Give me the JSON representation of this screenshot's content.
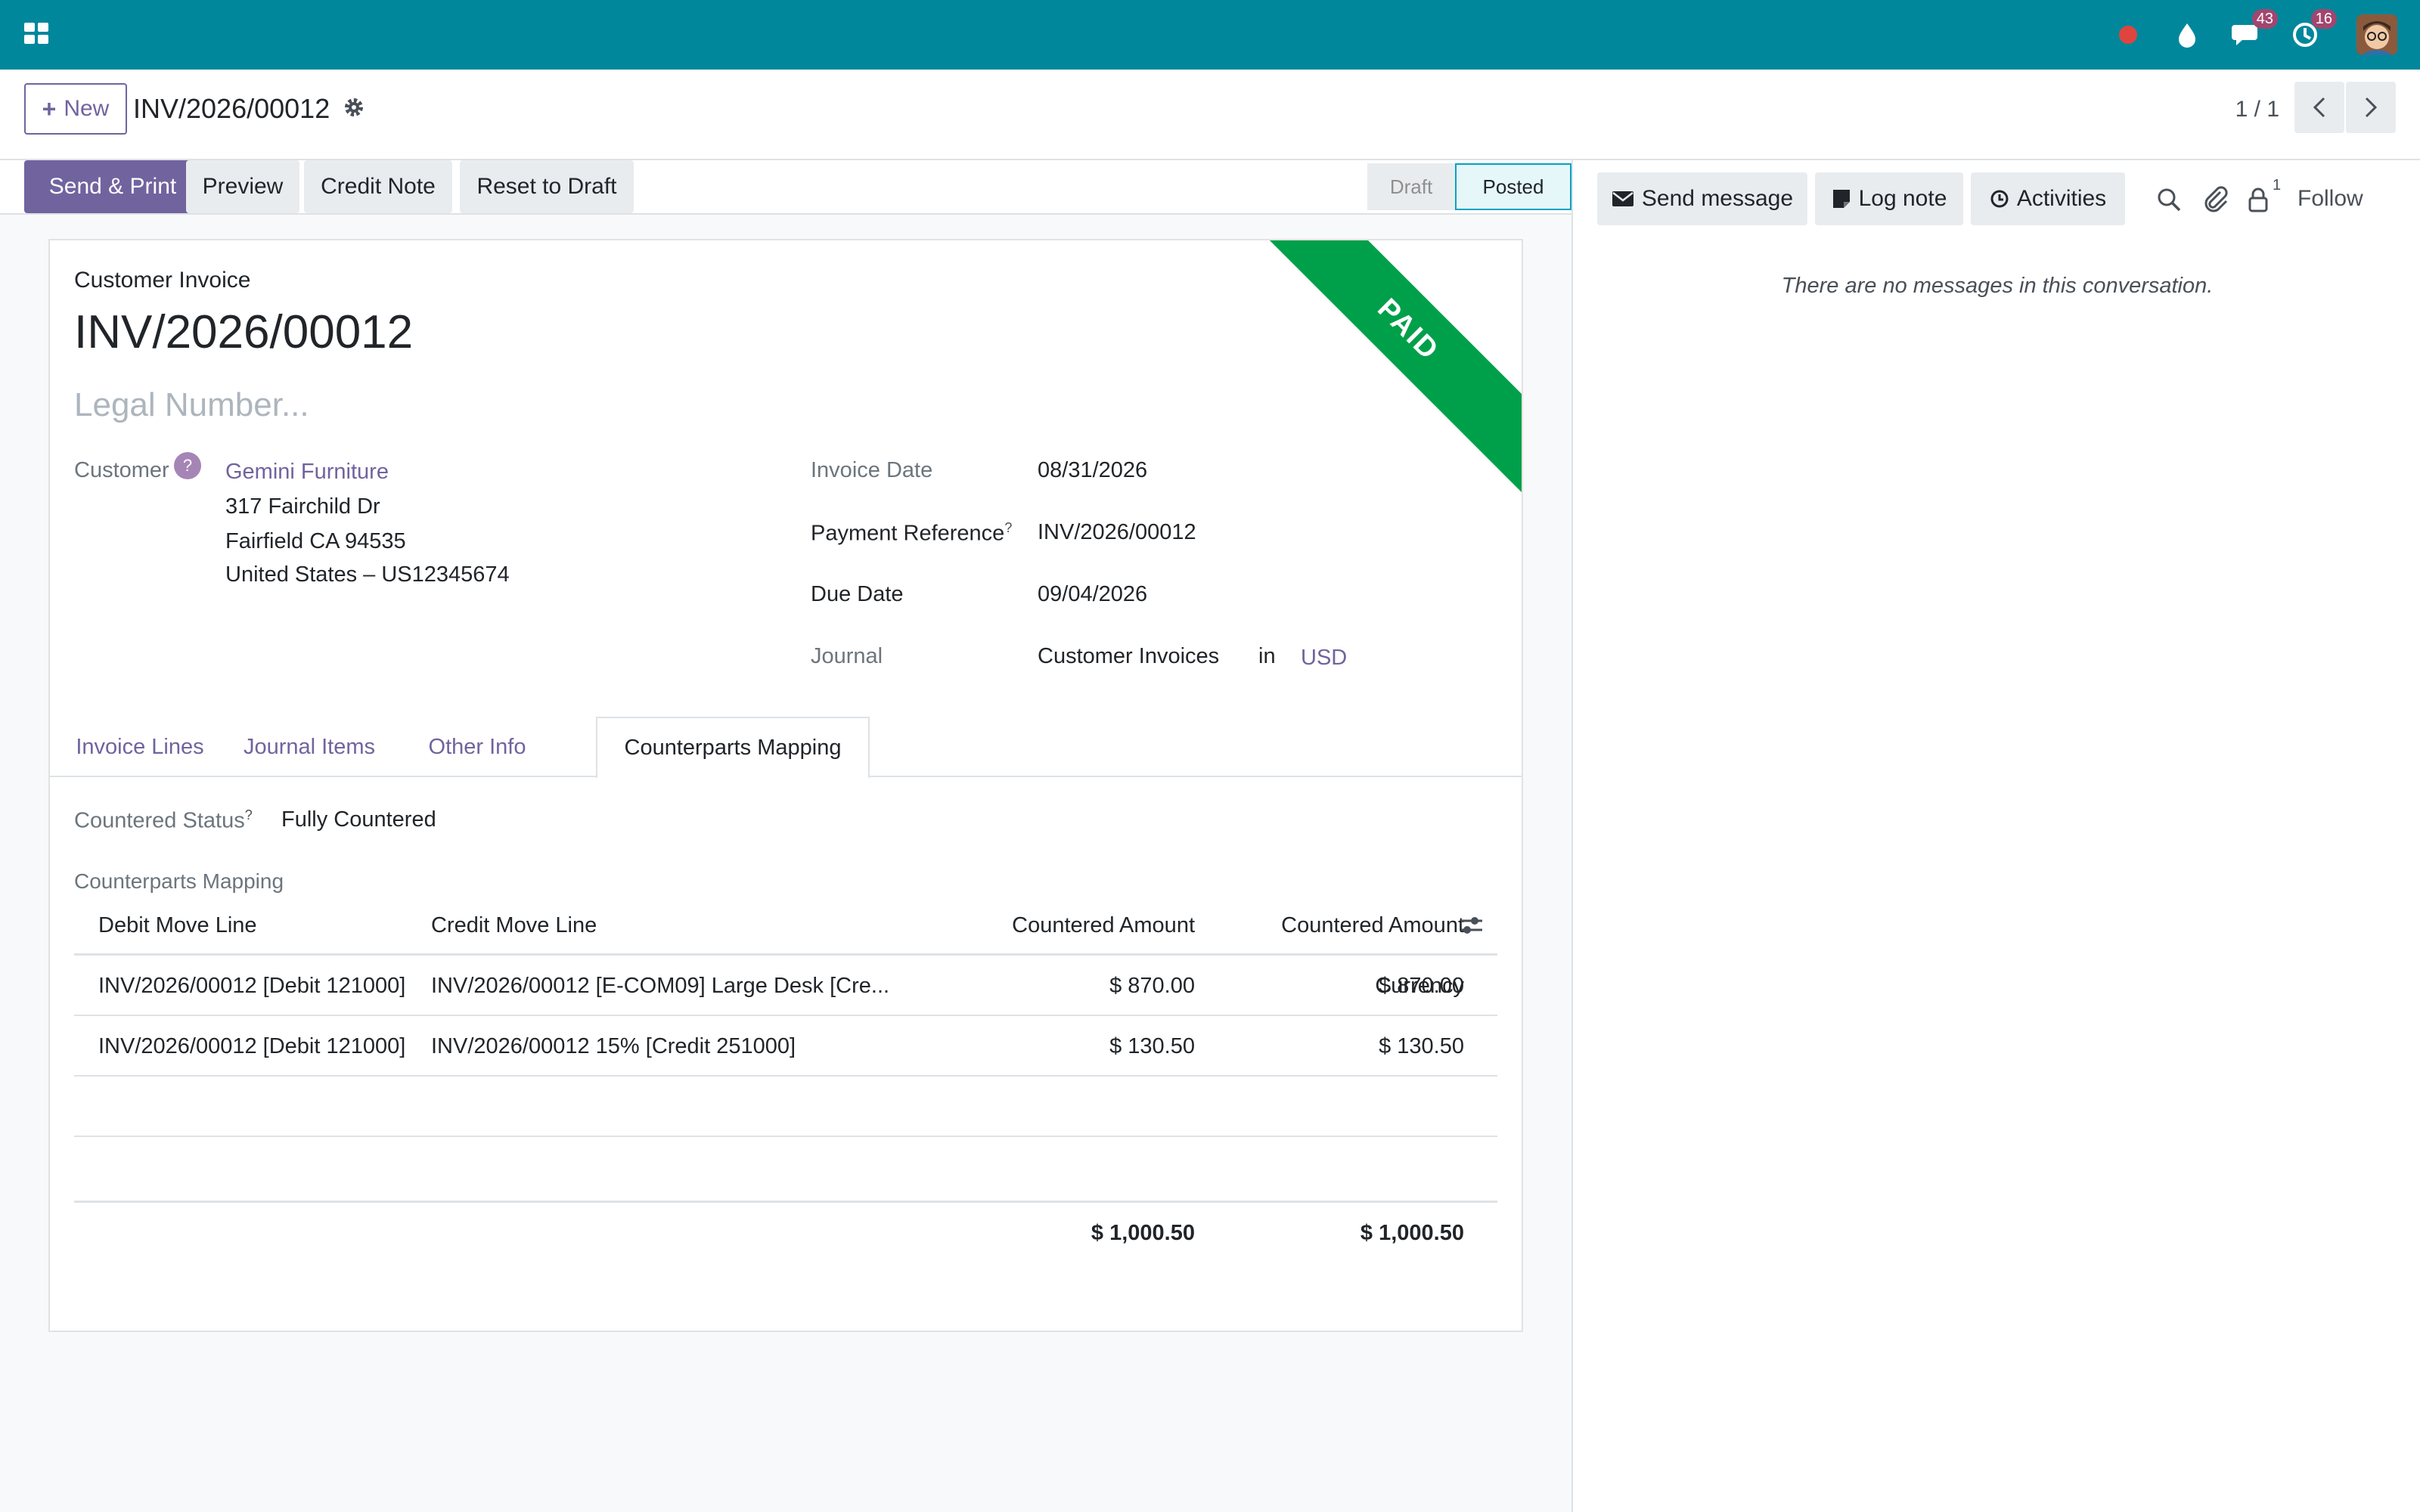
{
  "navbar": {
    "messages_badge": "43",
    "activities_badge": "16",
    "colors": {
      "bar": "#00879b",
      "badge": "#a2466f",
      "record_dot": "#e0443e"
    }
  },
  "control_panel": {
    "new_label": "New",
    "record_title": "INV/2026/00012",
    "pager": "1 / 1"
  },
  "statusbar": {
    "buttons": {
      "send_print": "Send & Print",
      "preview": "Preview",
      "credit_note": "Credit Note",
      "reset_draft": "Reset to Draft"
    },
    "stages": {
      "draft": "Draft",
      "posted": "Posted"
    },
    "current_stage": "Posted"
  },
  "sheet": {
    "ribbon": "PAID",
    "type_label": "Customer Invoice",
    "name": "INV/2026/00012",
    "legal_placeholder": "Legal Number...",
    "customer": {
      "label": "Customer",
      "help": "?",
      "name": "Gemini Furniture",
      "address_1": "317 Fairchild Dr",
      "address_2": "Fairfield CA 94535",
      "address_3": "United States – US12345674"
    },
    "invoice_date": {
      "label": "Invoice Date",
      "value": "08/31/2026"
    },
    "payment_reference": {
      "label": "Payment Reference",
      "help": "?",
      "value": "INV/2026/00012"
    },
    "due_date": {
      "label": "Due Date",
      "value": "09/04/2026"
    },
    "journal": {
      "label": "Journal",
      "value": "Customer Invoices",
      "in_label": "in",
      "currency": "USD"
    }
  },
  "tabs": [
    "Invoice Lines",
    "Journal Items",
    "Other Info",
    "Counterparts Mapping"
  ],
  "active_tab": "Counterparts Mapping",
  "countered": {
    "status_label": "Countered Status",
    "status_help": "?",
    "status_value": "Fully Countered",
    "section_label": "Counterparts Mapping"
  },
  "table": {
    "headers": {
      "debit": "Debit Move Line",
      "credit": "Credit Move Line",
      "amount": "Countered Amount",
      "amount_currency": "Countered Amount Currency"
    },
    "rows": [
      {
        "debit": "INV/2026/00012 [Debit 121000]",
        "credit": "INV/2026/00012 [E-COM09] Large Desk [Cre...",
        "amount": "$ 870.00",
        "amount_currency": "$ 870.00"
      },
      {
        "debit": "INV/2026/00012 [Debit 121000]",
        "credit": "INV/2026/00012 15% [Credit 251000]",
        "amount": "$ 130.50",
        "amount_currency": "$ 130.50"
      }
    ],
    "totals": {
      "amount": "$ 1,000.50",
      "amount_currency": "$ 1,000.50"
    }
  },
  "chatter": {
    "send_message": "Send message",
    "log_note": "Log note",
    "activities": "Activities",
    "follower_count": "1",
    "follow": "Follow",
    "empty": "There are no messages in this conversation."
  }
}
